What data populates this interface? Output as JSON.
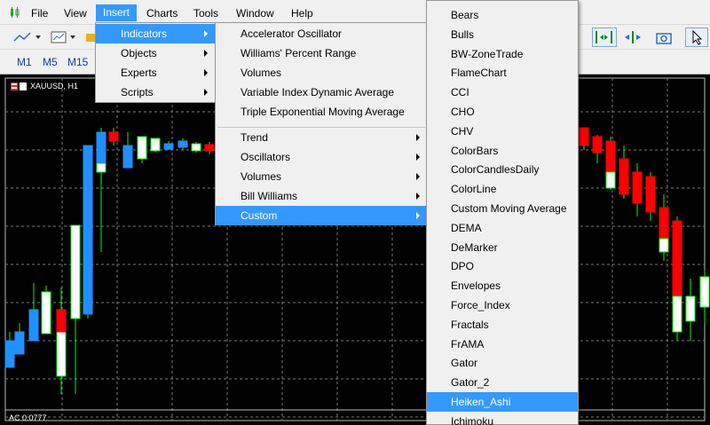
{
  "menubar": {
    "items": [
      "File",
      "View",
      "Insert",
      "Charts",
      "Tools",
      "Window",
      "Help"
    ],
    "active": "Insert"
  },
  "timeframes": [
    "M1",
    "M5",
    "M15"
  ],
  "chart": {
    "symbol": "XAUUSD, H1",
    "indicator_label": "AC 0.0777",
    "up_color": "#ffffff",
    "down_color": "#ff0000",
    "bull_body_color": "#1e90ff",
    "wick_color": "#00ff00"
  },
  "insert_menu": {
    "items": [
      {
        "label": "Indicators",
        "submenu": true,
        "highlighted": true
      },
      {
        "label": "Objects",
        "submenu": true
      },
      {
        "label": "Experts",
        "submenu": true
      },
      {
        "label": "Scripts",
        "submenu": true
      }
    ]
  },
  "indicators_menu": {
    "items": [
      {
        "label": "Accelerator Oscillator"
      },
      {
        "label": "Williams' Percent Range"
      },
      {
        "label": "Volumes"
      },
      {
        "label": "Variable Index Dynamic Average"
      },
      {
        "label": "Triple Exponential Moving Average"
      }
    ],
    "groups": [
      {
        "label": "Trend",
        "submenu": true
      },
      {
        "label": "Oscillators",
        "submenu": true
      },
      {
        "label": "Volumes",
        "submenu": true
      },
      {
        "label": "Bill Williams",
        "submenu": true
      },
      {
        "label": "Custom",
        "submenu": true,
        "highlighted": true
      }
    ]
  },
  "custom_menu": {
    "items": [
      "Bears",
      "Bulls",
      "BW-ZoneTrade",
      "FlameChart",
      "CCI",
      "CHO",
      "CHV",
      "ColorBars",
      "ColorCandlesDaily",
      "ColorLine",
      "Custom Moving Average",
      "DEMA",
      "DeMarker",
      "DPO",
      "Envelopes",
      "Force_Index",
      "Fractals",
      "FrAMA",
      "Gator",
      "Gator_2",
      "Heiken_Ashi",
      "Ichimoku"
    ],
    "highlighted": "Heiken_Ashi"
  }
}
